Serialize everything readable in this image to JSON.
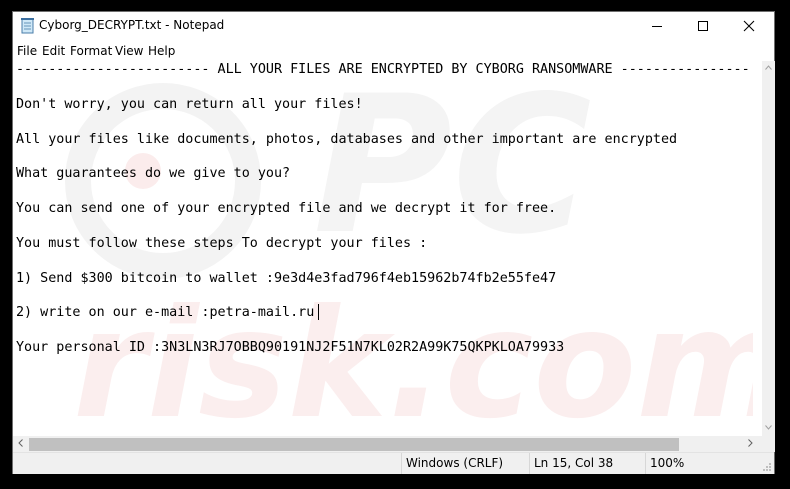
{
  "window": {
    "title": "Cyborg_DECRYPT.txt - Notepad"
  },
  "menu": [
    "File",
    "Edit",
    "Format",
    "View",
    "Help"
  ],
  "document": {
    "lines": [
      "------------------------ ALL YOUR FILES ARE ENCRYPTED BY CYBORG RANSOMWARE ----------------",
      "Don't worry, you can return all your files!",
      "All your files like documents, photos, databases and other important are encrypted",
      "What guarantees do we give to you?",
      "You can send one of your encrypted file and we decrypt it for free.",
      "You must follow these steps To decrypt your files :",
      "1) Send $300 bitcoin to wallet :9e3d4e3fad796f4eb15962b74fb2e55fe47",
      "2) write on our e-mail :petra-mail.ru",
      "Your personal ID :3N3LN3RJ7OBBQ90191NJ2F51N7KL02R2A99K75QKPKLOA79933"
    ]
  },
  "watermark": {
    "text": "risk.com",
    "logo_letters": "PC"
  },
  "status": {
    "encoding": "Windows (CRLF)",
    "position": "Ln 15, Col 38",
    "zoom": "100%"
  },
  "icons": {
    "app": "notepad-icon",
    "minimize": "minimize-icon",
    "maximize": "maximize-icon",
    "close": "close-icon"
  }
}
